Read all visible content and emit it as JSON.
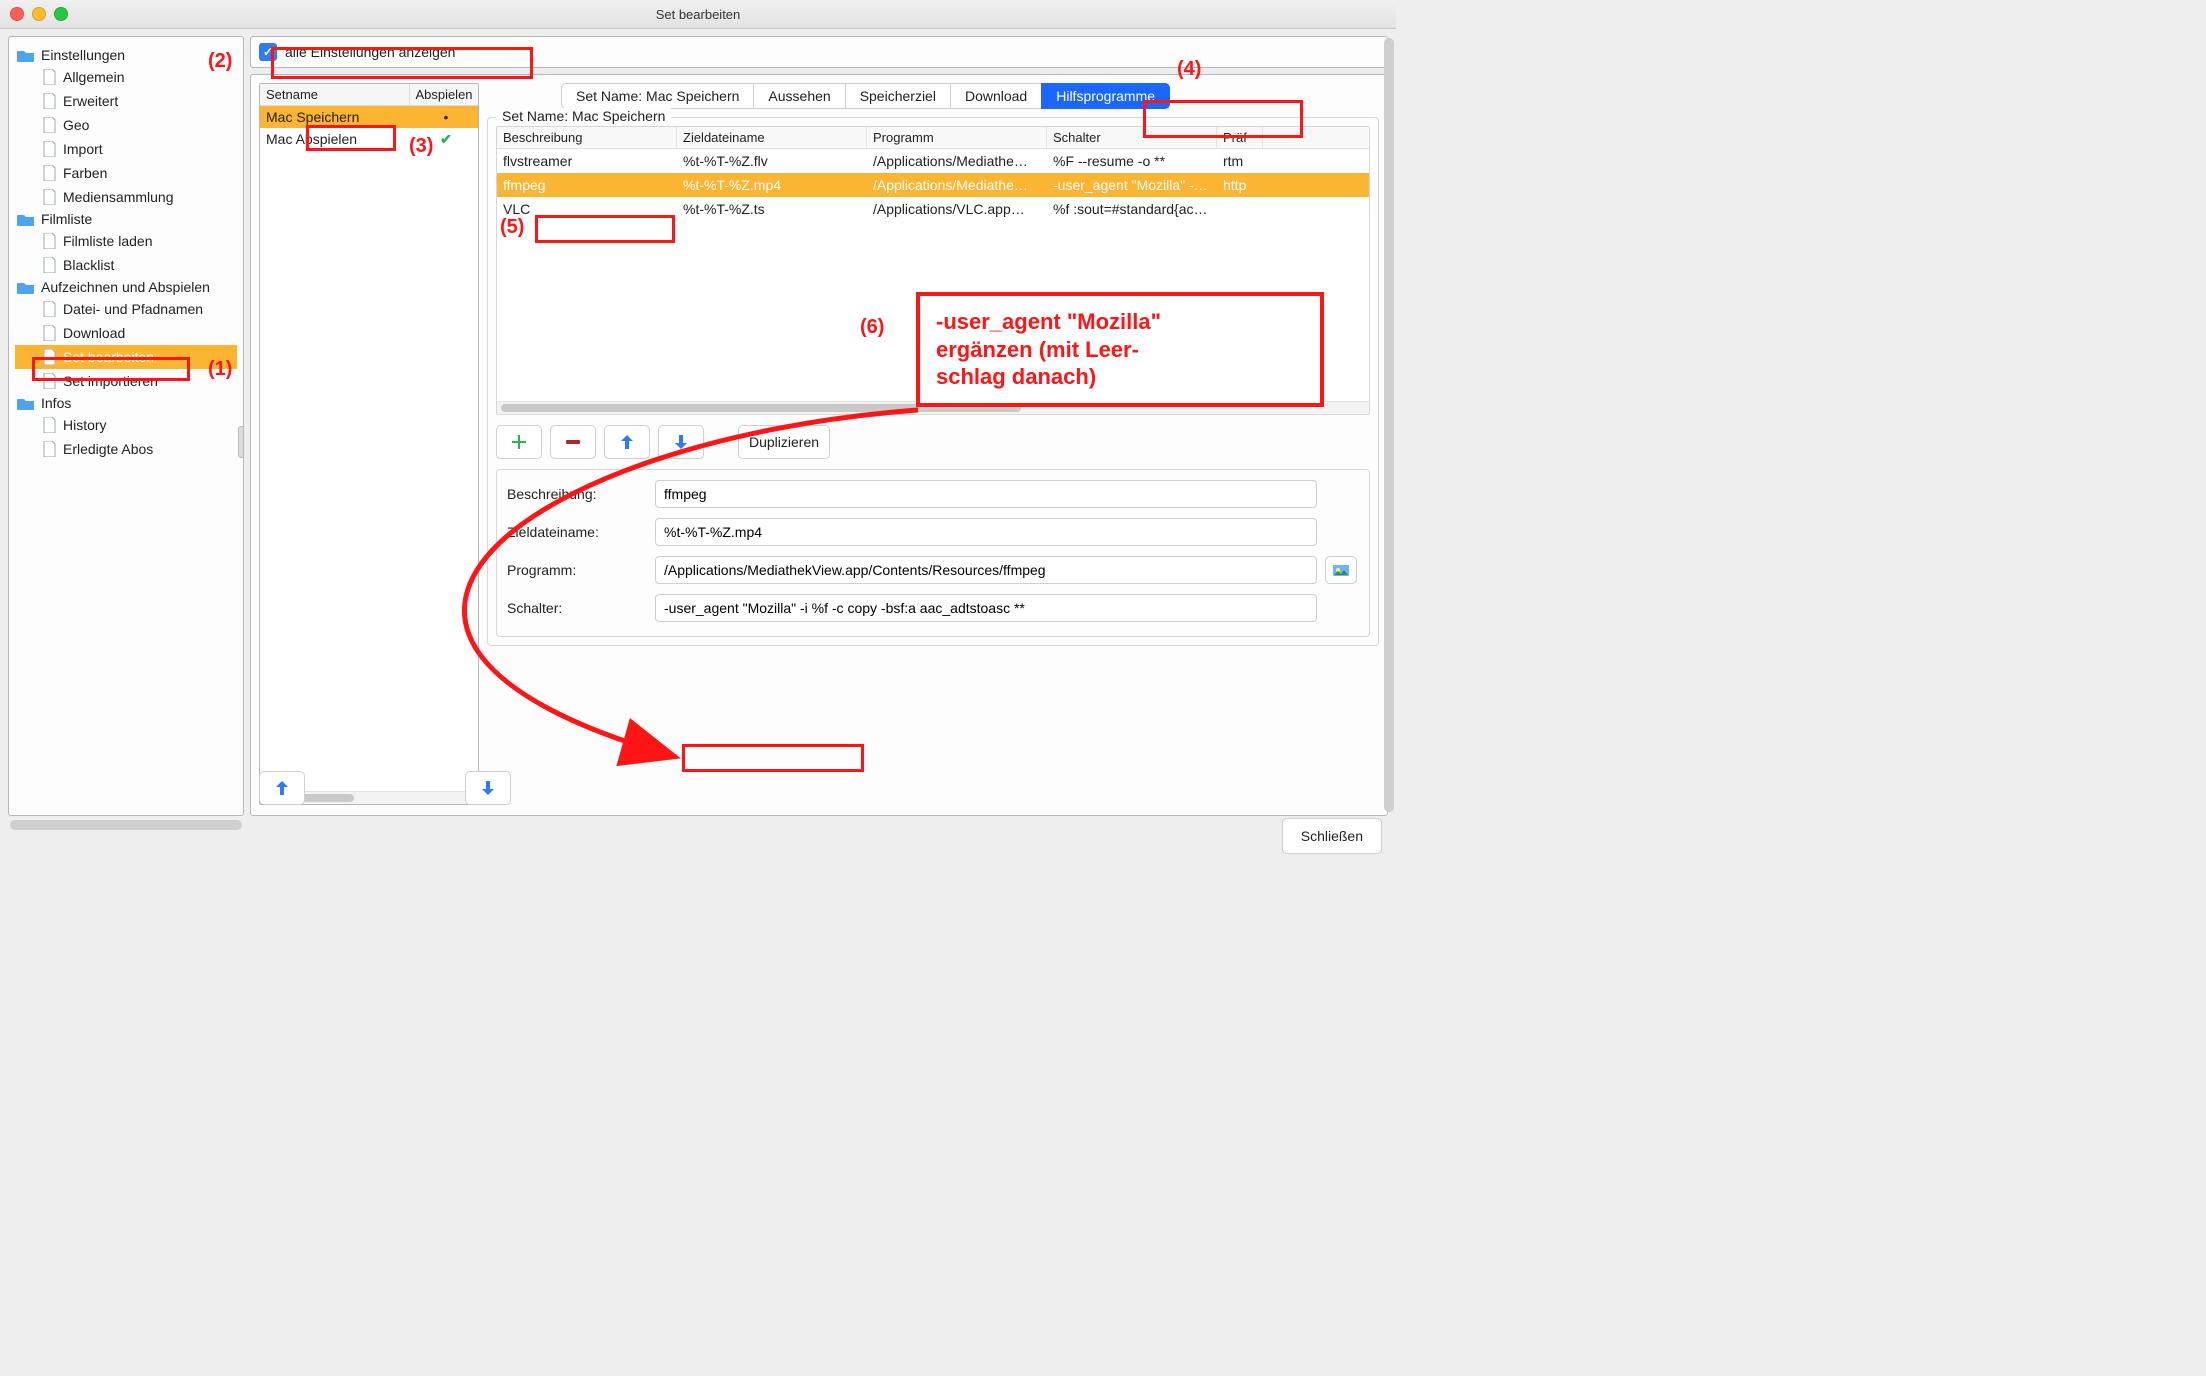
{
  "window": {
    "title": "Set bearbeiten"
  },
  "sidebar": {
    "groups": [
      {
        "label": "Einstellungen",
        "items": [
          "Allgemein",
          "Erweitert",
          "Geo",
          "Import",
          "Farben",
          "Mediensammlung"
        ]
      },
      {
        "label": "Filmliste",
        "items": [
          "Filmliste laden",
          "Blacklist"
        ]
      },
      {
        "label": "Aufzeichnen und Abspielen",
        "items": [
          "Datei- und Pfadnamen",
          "Download",
          "Set bearbeiten",
          "Set importieren"
        ],
        "selected": 2
      },
      {
        "label": "Infos",
        "items": [
          "History",
          "Erledigte Abos"
        ]
      }
    ]
  },
  "show_all": {
    "label": "alle Einstellungen anzeigen",
    "checked": true
  },
  "setlist": {
    "columns": [
      "Setname",
      "Abspielen"
    ],
    "rows": [
      {
        "name": "Mac Speichern",
        "play": "•",
        "selected": true
      },
      {
        "name": "Mac Abspielen",
        "play": "✓",
        "selected": false
      }
    ]
  },
  "tabs": {
    "items": [
      "Set Name: Mac Speichern",
      "Aussehen",
      "Speicherziel",
      "Download",
      "Hilfsprogramme"
    ],
    "selected": 4
  },
  "group_title": "Set Name: Mac Speichern",
  "progtable": {
    "columns": [
      "Beschreibung",
      "Zieldateiname",
      "Programm",
      "Schalter",
      "Präf"
    ],
    "rows": [
      {
        "desc": "flvstreamer",
        "target": "%t-%T-%Z.flv",
        "program": "/Applications/Mediathe…",
        "switch": "%F --resume -o **",
        "pref": "rtm"
      },
      {
        "desc": "ffmpeg",
        "target": "%t-%T-%Z.mp4",
        "program": "/Applications/Mediathe…",
        "switch": "-user_agent \"Mozilla\" -…",
        "pref": "http",
        "selected": true
      },
      {
        "desc": "VLC",
        "target": "%t-%T-%Z.ts",
        "program": "/Applications/VLC.app…",
        "switch": "%f :sout=#standard{ac…",
        "pref": ""
      }
    ]
  },
  "toolbar": {
    "duplicate": "Duplizieren"
  },
  "form": {
    "rows": {
      "desc": {
        "label": "Beschreibung:",
        "value": "ffmpeg"
      },
      "target": {
        "label": "Zieldateiname:",
        "value": "%t-%T-%Z.mp4"
      },
      "program": {
        "label": "Programm:",
        "value": "/Applications/MediathekView.app/Contents/Resources/ffmpeg"
      },
      "switch": {
        "label": "Schalter:",
        "value": "-user_agent \"Mozilla\" -i %f -c copy -bsf:a aac_adtstoasc **"
      }
    }
  },
  "close_label": "Schließen",
  "annotations": {
    "l1": "(1)",
    "l2": "(2)",
    "l3": "(3)",
    "l4": "(4)",
    "l5": "(5)",
    "l6": "(6)",
    "callout_line1": "-user_agent \"Mozilla\"",
    "callout_line2": "ergänzen (mit Leer-",
    "callout_line3": "schlag danach)",
    "schalter_highlight": "-user_agent \"Mozilla\""
  }
}
